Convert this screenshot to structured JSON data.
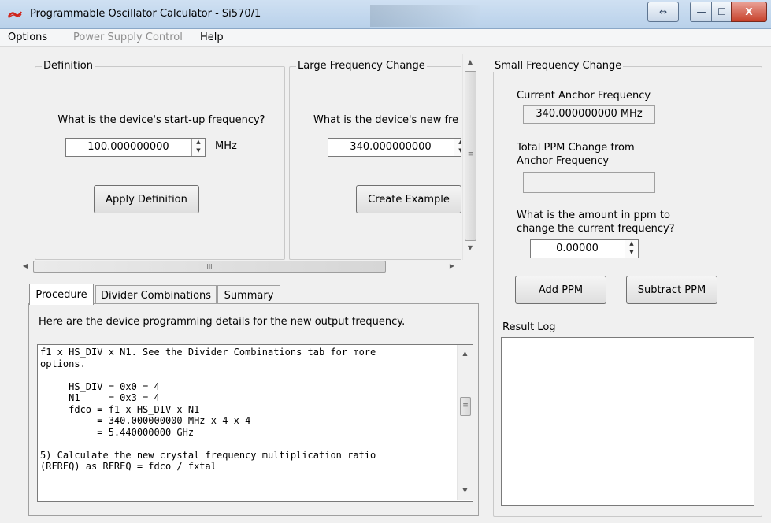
{
  "window": {
    "title": "Programmable Oscillator Calculator - Si570/1",
    "icon": "silicon-labs-logo-icon",
    "controls": {
      "restore_icon": "⇔",
      "min_icon": "—",
      "max_icon": "☐",
      "close_icon": "X"
    }
  },
  "menu": [
    "Options",
    "Power Supply Control",
    "Help"
  ],
  "definition": {
    "legend": "Definition",
    "question": "What is the device's start-up frequency?",
    "value": "100.000000000",
    "unit": "MHz",
    "button": "Apply Definition"
  },
  "large_change": {
    "legend": "Large Frequency Change",
    "question": "What is the device's new fre",
    "value": "340.000000000",
    "button": "Create Example"
  },
  "hscroll": {
    "thumb_label": "III"
  },
  "tabs": [
    "Procedure",
    "Divider Combinations",
    "Summary"
  ],
  "procedure": {
    "intro": "Here are the device programming details for the new output frequency.",
    "text_lines": [
      "f1 x HS_DIV x N1. See the Divider Combinations tab for more",
      "options.",
      "",
      "     HS_DIV = 0x0 = 4",
      "     N1     = 0x3 = 4",
      "     fdco = f1 x HS_DIV x N1",
      "          = 340.000000000 MHz x 4 x 4",
      "          = 5.440000000 GHz",
      "",
      "5) Calculate the new crystal frequency multiplication ratio",
      "(RFREQ) as RFREQ = fdco / fxtal"
    ]
  },
  "small_change": {
    "legend": "Small Frequency Change",
    "anchor_label": "Current Anchor Frequency",
    "anchor_value": "340.000000000 MHz",
    "total_label_1": "Total PPM Change from",
    "total_label_2": "Anchor Frequency",
    "total_value": "",
    "ppm_label_1": "What is the amount in ppm to",
    "ppm_label_2": "change the current frequency?",
    "ppm_value": "0.00000",
    "add_button": "Add PPM",
    "subtract_button": "Subtract PPM",
    "log_label": "Result Log"
  }
}
